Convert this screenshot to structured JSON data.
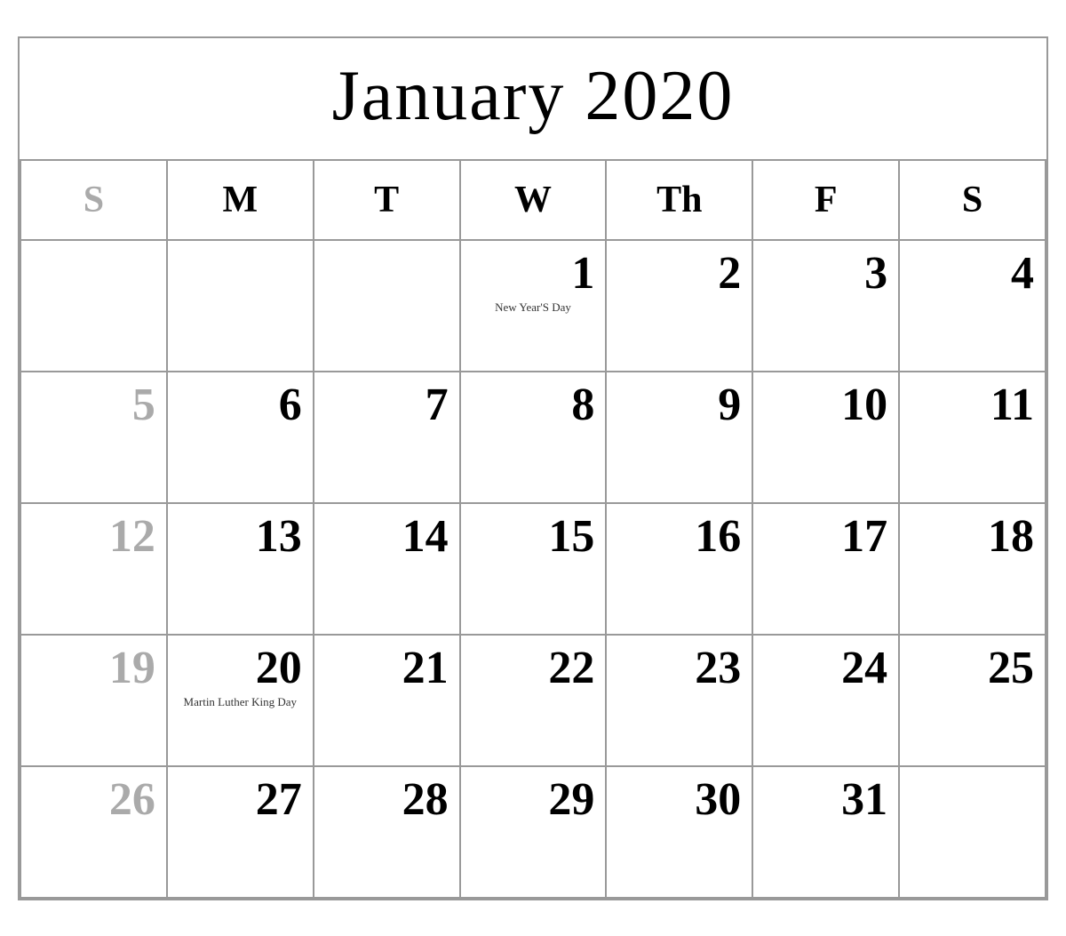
{
  "calendar": {
    "title": "January 2020",
    "headers": [
      {
        "label": "S",
        "isSunday": true
      },
      {
        "label": "M",
        "isSunday": false
      },
      {
        "label": "T",
        "isSunday": false
      },
      {
        "label": "W",
        "isSunday": false
      },
      {
        "label": "Th",
        "isSunday": false
      },
      {
        "label": "F",
        "isSunday": false
      },
      {
        "label": "S",
        "isSunday": false
      }
    ],
    "weeks": [
      [
        {
          "day": "",
          "empty": true,
          "sunday": true
        },
        {
          "day": "",
          "empty": true,
          "sunday": false
        },
        {
          "day": "",
          "empty": true,
          "sunday": false
        },
        {
          "day": "1",
          "empty": false,
          "sunday": false,
          "holiday": "New Year'S Day"
        },
        {
          "day": "2",
          "empty": false,
          "sunday": false
        },
        {
          "day": "3",
          "empty": false,
          "sunday": false
        },
        {
          "day": "4",
          "empty": false,
          "sunday": false
        }
      ],
      [
        {
          "day": "5",
          "empty": false,
          "sunday": true
        },
        {
          "day": "6",
          "empty": false,
          "sunday": false
        },
        {
          "day": "7",
          "empty": false,
          "sunday": false
        },
        {
          "day": "8",
          "empty": false,
          "sunday": false
        },
        {
          "day": "9",
          "empty": false,
          "sunday": false
        },
        {
          "day": "10",
          "empty": false,
          "sunday": false
        },
        {
          "day": "11",
          "empty": false,
          "sunday": false
        }
      ],
      [
        {
          "day": "12",
          "empty": false,
          "sunday": true
        },
        {
          "day": "13",
          "empty": false,
          "sunday": false
        },
        {
          "day": "14",
          "empty": false,
          "sunday": false
        },
        {
          "day": "15",
          "empty": false,
          "sunday": false
        },
        {
          "day": "16",
          "empty": false,
          "sunday": false
        },
        {
          "day": "17",
          "empty": false,
          "sunday": false
        },
        {
          "day": "18",
          "empty": false,
          "sunday": false
        }
      ],
      [
        {
          "day": "19",
          "empty": false,
          "sunday": true
        },
        {
          "day": "20",
          "empty": false,
          "sunday": false,
          "holiday": "Martin Luther\nKing Day"
        },
        {
          "day": "21",
          "empty": false,
          "sunday": false
        },
        {
          "day": "22",
          "empty": false,
          "sunday": false
        },
        {
          "day": "23",
          "empty": false,
          "sunday": false
        },
        {
          "day": "24",
          "empty": false,
          "sunday": false
        },
        {
          "day": "25",
          "empty": false,
          "sunday": false
        }
      ],
      [
        {
          "day": "26",
          "empty": false,
          "sunday": true
        },
        {
          "day": "27",
          "empty": false,
          "sunday": false
        },
        {
          "day": "28",
          "empty": false,
          "sunday": false
        },
        {
          "day": "29",
          "empty": false,
          "sunday": false
        },
        {
          "day": "30",
          "empty": false,
          "sunday": false
        },
        {
          "day": "31",
          "empty": false,
          "sunday": false
        },
        {
          "day": "",
          "empty": true,
          "sunday": false
        }
      ]
    ]
  }
}
